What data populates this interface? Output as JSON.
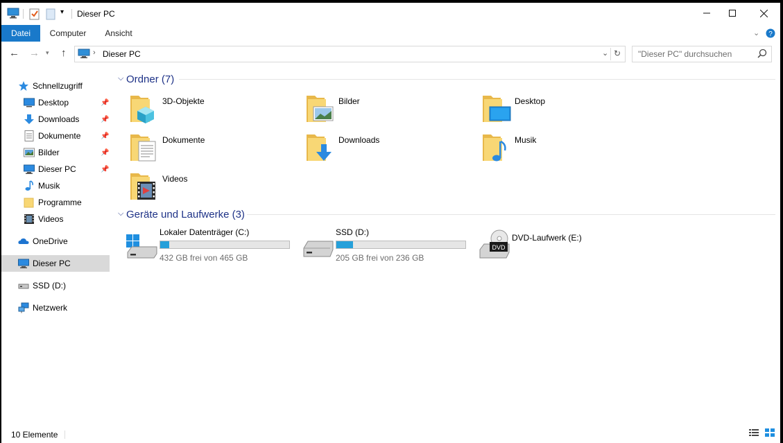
{
  "window": {
    "title": "Dieser PC",
    "controls": [
      "minimize",
      "maximize",
      "close"
    ]
  },
  "ribbon": {
    "tabs": [
      "Datei",
      "Computer",
      "Ansicht"
    ]
  },
  "address": {
    "path": "Dieser PC",
    "search_placeholder": "\"Dieser PC\" durchsuchen"
  },
  "sidebar": {
    "quick_access": "Schnellzugriff",
    "items": [
      {
        "label": "Desktop",
        "icon": "desktop-icon",
        "pinned": true
      },
      {
        "label": "Downloads",
        "icon": "download-arrow-icon",
        "pinned": true
      },
      {
        "label": "Dokumente",
        "icon": "document-icon",
        "pinned": true
      },
      {
        "label": "Bilder",
        "icon": "picture-icon",
        "pinned": true
      },
      {
        "label": "Dieser PC",
        "icon": "computer-icon",
        "pinned": true
      },
      {
        "label": "Musik",
        "icon": "music-note-icon",
        "pinned": false
      },
      {
        "label": "Programme",
        "icon": "folder-icon",
        "pinned": false
      },
      {
        "label": "Videos",
        "icon": "film-icon",
        "pinned": false
      }
    ],
    "onedrive": "OneDrive",
    "this_pc": "Dieser PC",
    "ssd": "SSD (D:)",
    "network": "Netzwerk"
  },
  "content": {
    "folders_header": "Ordner (7)",
    "folders": [
      {
        "name": "3D-Objekte"
      },
      {
        "name": "Bilder"
      },
      {
        "name": "Desktop"
      },
      {
        "name": "Dokumente"
      },
      {
        "name": "Downloads"
      },
      {
        "name": "Musik"
      },
      {
        "name": "Videos"
      }
    ],
    "drives_header": "Geräte und Laufwerke (3)",
    "drives": [
      {
        "name": "Lokaler Datenträger (C:)",
        "free_text": "432 GB frei von 465 GB",
        "used_fraction": 0.071
      },
      {
        "name": "SSD (D:)",
        "free_text": "205 GB frei von 236 GB",
        "used_fraction": 0.131
      },
      {
        "name": "DVD-Laufwerk (E:)"
      }
    ]
  },
  "status": {
    "count": "10 Elemente"
  },
  "colors": {
    "accent": "#1979ca",
    "folder": "#f8d775",
    "group_title": "#1e3287",
    "drive_fill": "#26a0da"
  }
}
